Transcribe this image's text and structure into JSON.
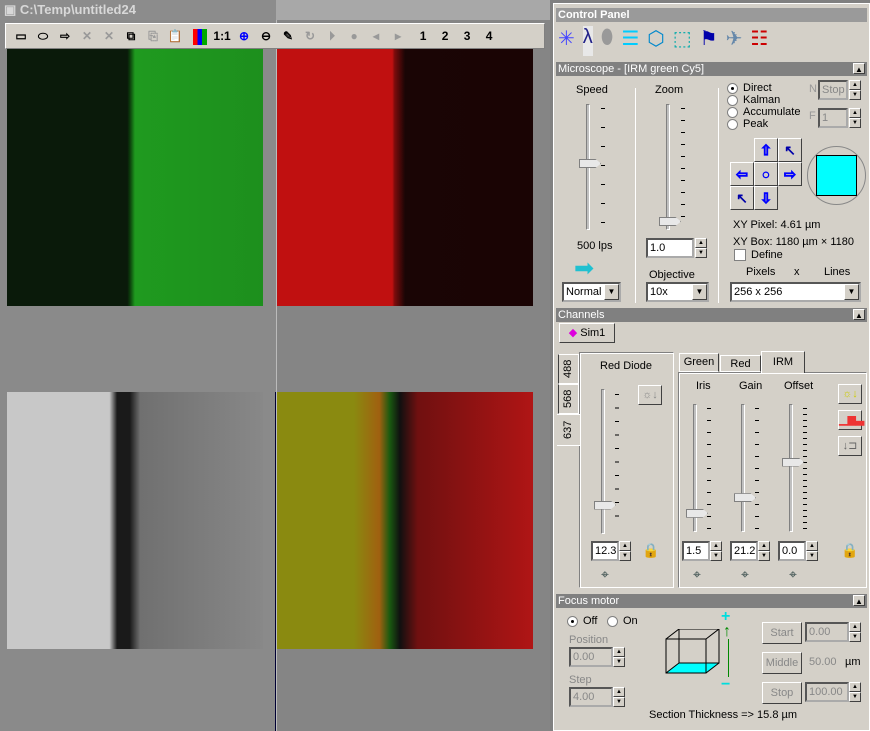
{
  "window": {
    "title": "C:\\Temp\\untitled24",
    "toolbar": [
      "rectangle-icon",
      "ellipse-icon",
      "polygon-icon",
      "delete-icon",
      "delete-all-icon",
      "select-icon",
      "copy-icon",
      "paste-icon",
      "lut-icon",
      "1:1",
      "zoom-in-icon",
      "zoom-out-icon",
      "draw-icon",
      "loop-icon",
      "play-icon",
      "record-icon",
      "prev-icon",
      "next-icon",
      "1",
      "2",
      "3",
      "4"
    ]
  },
  "images": [
    {
      "name": "green-channel"
    },
    {
      "name": "red-channel"
    },
    {
      "name": "irm-channel"
    },
    {
      "name": "merged-channel"
    }
  ],
  "control_panel": {
    "title": "Control Panel",
    "icons": [
      "laser-icon",
      "lambda-icon",
      "sample-icon",
      "stack-icon",
      "3d-icon",
      "section-icon",
      "lamp-icon",
      "microscope-icon",
      "channel-routing-icon"
    ],
    "microscope": {
      "header": "Microscope - [IRM green Cy5]",
      "speed_label": "Speed",
      "speed_value": "500 lps",
      "scan_mode": "Normal",
      "zoom_label": "Zoom",
      "zoom_value": "1.0",
      "objective_label": "Objective",
      "objective": "10x",
      "modes": [
        "Direct",
        "Kalman",
        "Accumulate",
        "Peak"
      ],
      "selected_mode": "Direct",
      "n_label": "N",
      "n_value": "Stop",
      "f_label": "F",
      "f_value": "1",
      "xy_pixel": "XY Pixel:  4.61 µm",
      "xy_box": "XY Box:  1180 µm × 1180",
      "define_label": "Define",
      "pixels_label": "Pixels",
      "x_label": "x",
      "lines_label": "Lines",
      "resolution": "256 x 256"
    },
    "channels": {
      "header": "Channels",
      "sim_label": "Sim1",
      "laser_tabs": [
        "488",
        "568",
        "637"
      ],
      "active_laser": "637",
      "diode_label": "Red Diode",
      "diode_value": "12.3",
      "det_tabs": [
        "Green",
        "Red",
        "IRM"
      ],
      "active_det": "IRM",
      "iris_label": "Iris",
      "iris_value": "1.5",
      "gain_label": "Gain",
      "gain_value": "21.2",
      "offset_label": "Offset",
      "offset_value": "0.0",
      "diode_level": 0.18,
      "iris_level": 0.12,
      "gain_level": 0.25,
      "offset_level": 0.55
    },
    "focus": {
      "header": "Focus motor",
      "off_label": "Off",
      "on_label": "On",
      "selected": "Off",
      "position_label": "Position",
      "position_value": "0.00",
      "step_label": "Step",
      "step_value": "4.00",
      "start_label": "Start",
      "start_value": "0.00",
      "middle_label": "Middle",
      "middle_value": "50.00",
      "unit": "µm",
      "stop_label": "Stop",
      "stop_value": "100.00",
      "section": "Section Thickness => 15.8 µm",
      "plus": "+",
      "minus": "−"
    }
  }
}
